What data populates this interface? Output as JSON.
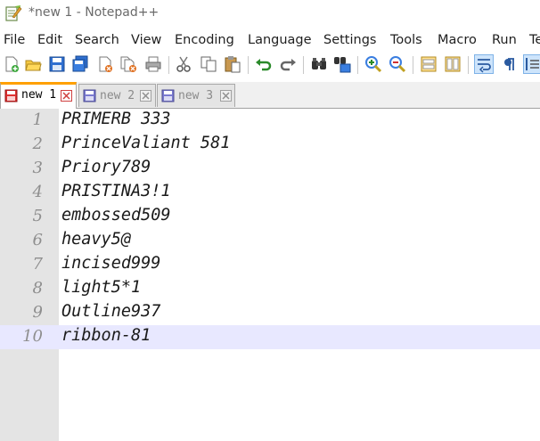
{
  "window": {
    "title": "*new 1 - Notepad++"
  },
  "menu": [
    "File",
    "Edit",
    "Search",
    "View",
    "Encoding",
    "Language",
    "Settings",
    "Tools",
    "Macro",
    "Run",
    "Te"
  ],
  "toolbar": [
    "new-file-icon",
    "open-file-icon",
    "save-icon",
    "save-all-icon",
    "close-icon",
    "close-all-icon",
    "print-icon",
    "cut-icon",
    "copy-icon",
    "paste-icon",
    "undo-icon",
    "redo-icon",
    "find-icon",
    "replace-icon",
    "zoom-in-icon",
    "zoom-out-icon",
    "sync-vertical-icon",
    "sync-horizontal-icon",
    "word-wrap-icon",
    "show-all-chars-icon",
    "indent-guide-icon"
  ],
  "tabs": [
    {
      "label": "new 1",
      "active": true,
      "saved": false
    },
    {
      "label": "new 2",
      "active": false,
      "saved": true
    },
    {
      "label": "new 3",
      "active": false,
      "saved": true
    }
  ],
  "editor": {
    "current_line": 10,
    "lines": [
      {
        "number": "1",
        "text": "PRIMERB 333"
      },
      {
        "number": "2",
        "text": "PrinceValiant 581"
      },
      {
        "number": "3",
        "text": "Priory789"
      },
      {
        "number": "4",
        "text": "PRISTINA3!1"
      },
      {
        "number": "5",
        "text": "embossed509"
      },
      {
        "number": "6",
        "text": "heavy5@"
      },
      {
        "number": "7",
        "text": "incised999"
      },
      {
        "number": "8",
        "text": "light5*1"
      },
      {
        "number": "9",
        "text": "Outline937"
      },
      {
        "number": "10",
        "text": "ribbon-81"
      }
    ]
  },
  "colors": {
    "tab_accent": "#ffa000",
    "current_line": "#e8e8ff",
    "gutter": "#e4e4e4",
    "tab_close": "#d04040"
  }
}
